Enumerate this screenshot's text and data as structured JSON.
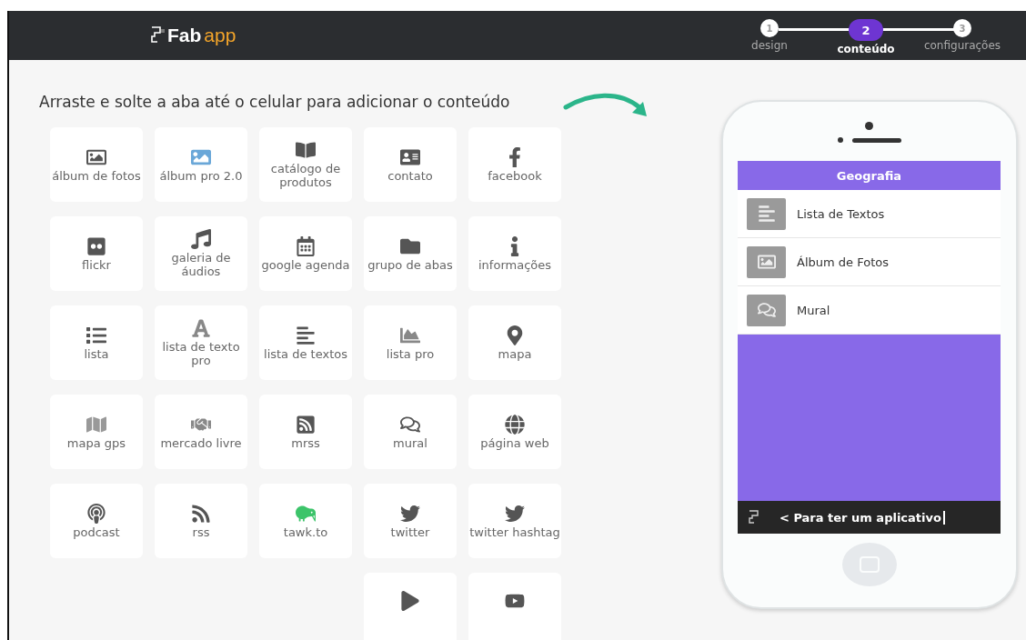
{
  "header": {
    "logo": {
      "part_1": "Fab",
      "part_2": "app"
    },
    "steps": [
      {
        "number": "1",
        "label": "design",
        "selected": false
      },
      {
        "number": "2",
        "label": "conteúdo",
        "selected": true
      },
      {
        "number": "3",
        "label": "configurações",
        "selected": false
      }
    ]
  },
  "instruction": "Arraste e solte a aba até o celular para adicionar o conteúdo",
  "tiles": [
    {
      "label": "álbum de fotos"
    },
    {
      "label": "álbum pro 2.0"
    },
    {
      "label": "catálogo de produtos"
    },
    {
      "label": "contato"
    },
    {
      "label": "facebook"
    },
    {
      "label": "flickr"
    },
    {
      "label": "galeria de áudios"
    },
    {
      "label": "google agenda"
    },
    {
      "label": "grupo de abas"
    },
    {
      "label": "informações"
    },
    {
      "label": "lista"
    },
    {
      "label": "lista de texto pro"
    },
    {
      "label": "lista de textos"
    },
    {
      "label": "lista pro"
    },
    {
      "label": "mapa"
    },
    {
      "label": "mapa gps"
    },
    {
      "label": "mercado livre"
    },
    {
      "label": "mrss"
    },
    {
      "label": "mural"
    },
    {
      "label": "página web"
    },
    {
      "label": "podcast"
    },
    {
      "label": "rss"
    },
    {
      "label": "tawk.to"
    },
    {
      "label": "twitter"
    },
    {
      "label": "twitter hashtag"
    },
    {
      "kind": "spacer"
    },
    {
      "kind": "spacer"
    },
    {
      "kind": "spacer"
    },
    {
      "kind": "cut"
    },
    {
      "kind": "cut"
    }
  ],
  "phone": {
    "title": "Geografia",
    "items": [
      {
        "label": "Lista de Textos"
      },
      {
        "label": "Álbum de Fotos"
      },
      {
        "label": "Mural"
      }
    ],
    "footer": "< Para ter um aplicativo"
  }
}
